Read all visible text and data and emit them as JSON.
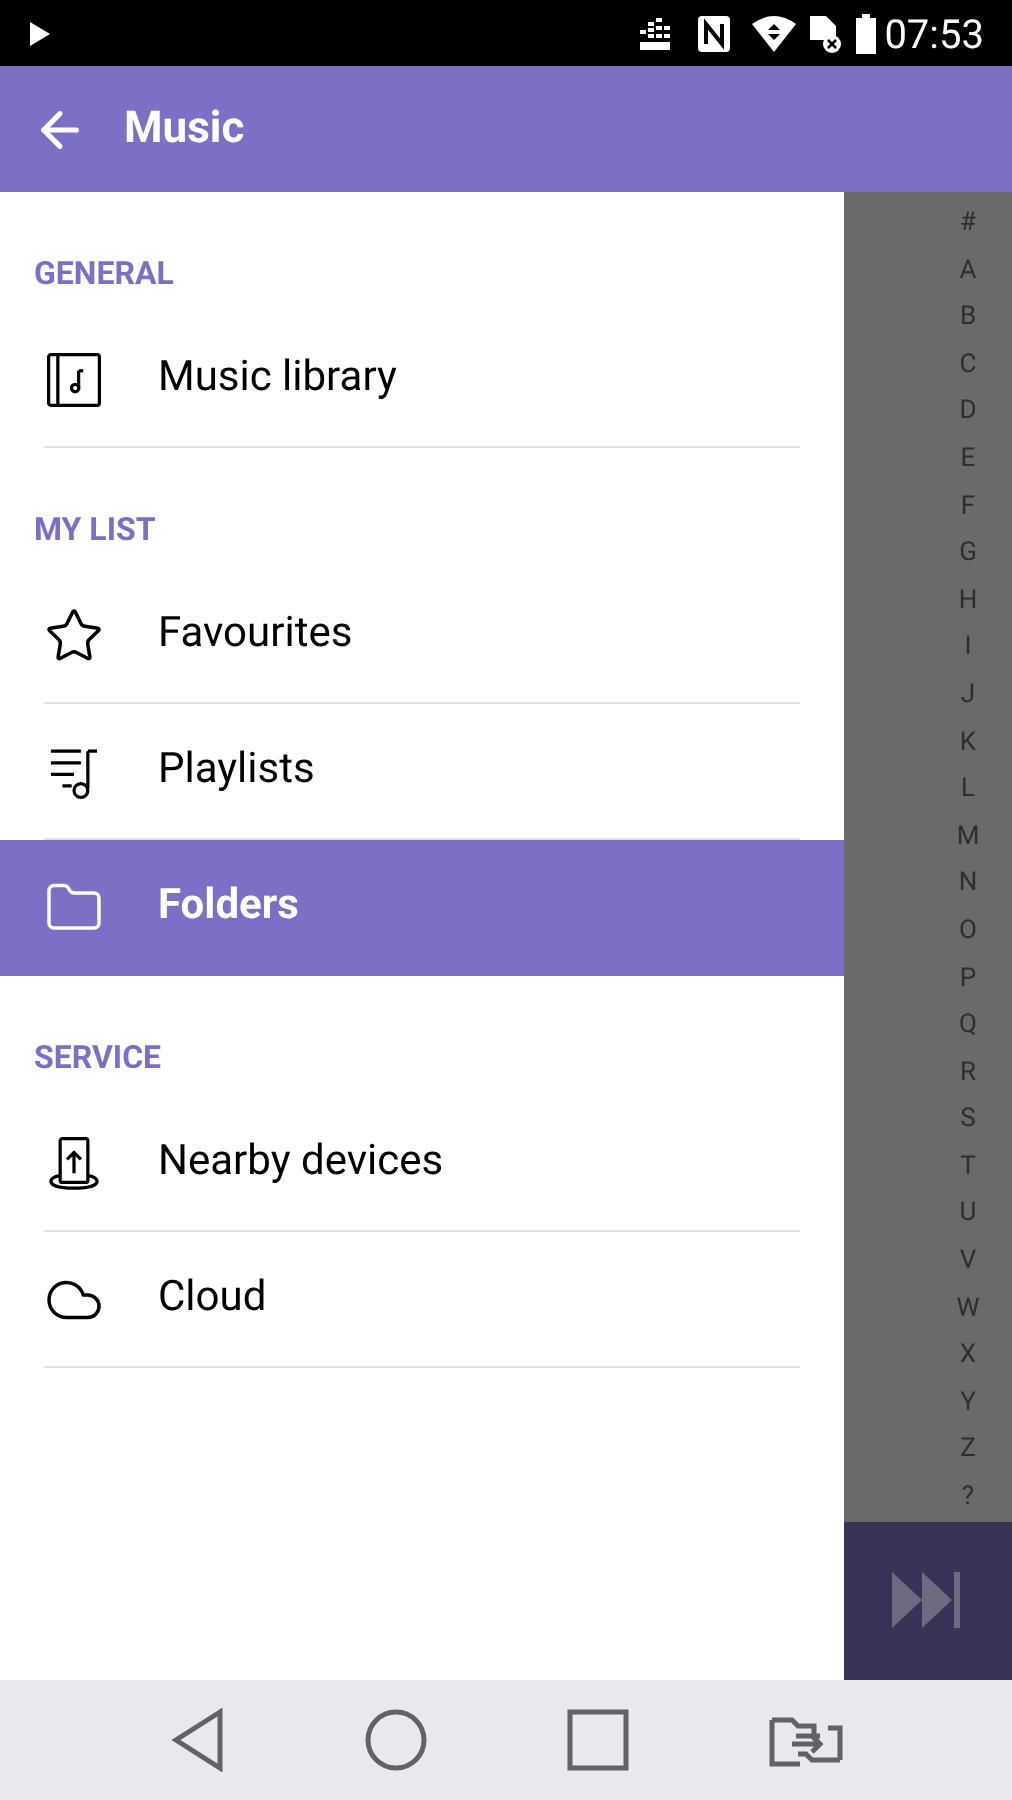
{
  "status_bar": {
    "time": "07:53"
  },
  "app_bar": {
    "title": "Music"
  },
  "drawer": {
    "sections": [
      {
        "heading": "GENERAL",
        "items": [
          {
            "label": "Music library",
            "selected": false
          }
        ]
      },
      {
        "heading": "MY LIST",
        "items": [
          {
            "label": "Favourites",
            "selected": false
          },
          {
            "label": "Playlists",
            "selected": false
          },
          {
            "label": "Folders",
            "selected": true
          }
        ]
      },
      {
        "heading": "SERVICE",
        "items": [
          {
            "label": "Nearby devices",
            "selected": false
          },
          {
            "label": "Cloud",
            "selected": false
          }
        ]
      }
    ]
  },
  "index_bar": [
    "#",
    "A",
    "B",
    "C",
    "D",
    "E",
    "F",
    "G",
    "H",
    "I",
    "J",
    "K",
    "L",
    "M",
    "N",
    "O",
    "P",
    "Q",
    "R",
    "S",
    "T",
    "U",
    "V",
    "W",
    "X",
    "Y",
    "Z",
    "?"
  ]
}
